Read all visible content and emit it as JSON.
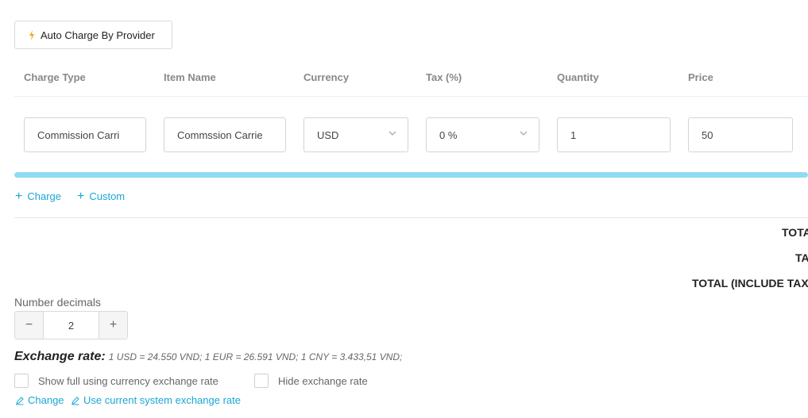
{
  "toolbar": {
    "auto_charge_label": "Auto Charge By Provider",
    "auto_charge_icon": "lightning-icon",
    "accent_color": "#f5a623"
  },
  "table": {
    "columns": [
      "Charge Type",
      "Item Name",
      "Currency",
      "Tax (%)",
      "Quantity",
      "Price"
    ],
    "row": {
      "charge_type": "Commission Carri",
      "item_name": "Commssion Carrie",
      "currency": "USD",
      "tax": "0 %",
      "quantity": "1",
      "price": "50"
    },
    "scroll_progress": 1.0
  },
  "actions": {
    "add_charge": "Charge",
    "add_custom": "Custom"
  },
  "totals": {
    "total_label": "TOTA",
    "tax_label": "TA",
    "total_incl_tax_label": "TOTAL (INCLUDE TAX"
  },
  "decimals": {
    "label": "Number decimals",
    "value": "2"
  },
  "exchange": {
    "label": "Exchange rate:",
    "value": "1 USD = 24.550 VND; 1 EUR = 26.591 VND; 1 CNY = 3.433,51 VND;",
    "show_full_label": "Show full using currency exchange rate",
    "hide_label": "Hide exchange rate",
    "change_label": "Change",
    "use_system_label": "Use current system exchange rate"
  },
  "colors": {
    "link": "#1aa6d6",
    "progress": "#8fdcf2"
  }
}
